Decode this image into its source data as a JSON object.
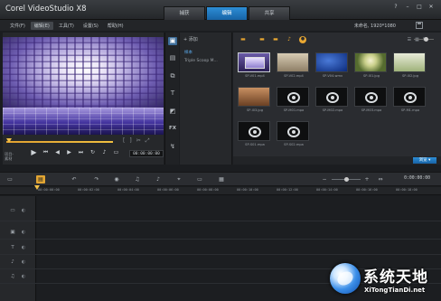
{
  "app": {
    "title": "Corel VideoStudio X8"
  },
  "steps": [
    {
      "label": "捕获",
      "active": false
    },
    {
      "label": "编辑",
      "active": true
    },
    {
      "label": "共享",
      "active": false
    }
  ],
  "window_controls": {
    "help": "?",
    "minimize": "–",
    "maximize": "□",
    "close": "✕"
  },
  "menu": [
    {
      "label": "文件(F)",
      "active": false
    },
    {
      "label": "编辑(E)",
      "active": true
    },
    {
      "label": "工具(T)",
      "active": false
    },
    {
      "label": "设置(S)",
      "active": false
    },
    {
      "label": "帮助(H)",
      "active": false
    }
  ],
  "user_status": "未命名, 1920*1080",
  "player": {
    "project_label": "项目-\n素材",
    "timecode": "00:00:00:00",
    "transport_icons": [
      "play-icon",
      "go-to-start-icon",
      "previous-frame-icon",
      "next-frame-icon",
      "go-to-end-icon",
      "repeat-icon",
      "volume-icon",
      "hd-icon"
    ],
    "trim_icons": [
      "mark-in-icon",
      "mark-out-icon",
      "split-clip-icon",
      "enlarge-icon"
    ]
  },
  "library_sidebar": [
    {
      "name": "media-icon",
      "glyph": "▣",
      "active": true
    },
    {
      "name": "instant-project-icon",
      "glyph": "▤",
      "active": false
    },
    {
      "name": "transition-icon",
      "glyph": "⧉",
      "active": false
    },
    {
      "name": "title-icon",
      "glyph": "T",
      "active": false
    },
    {
      "name": "graphic-icon",
      "glyph": "◩",
      "active": false
    },
    {
      "name": "filter-icon",
      "glyph": "FX",
      "active": false
    },
    {
      "name": "path-icon",
      "glyph": "↯",
      "active": false
    }
  ],
  "folder_panel": {
    "add_label": "+ 添加",
    "folders": [
      "样本",
      "Triple Scoop M..."
    ]
  },
  "media_panel": {
    "thumbnails": [
      {
        "label": "SP-V01.mp4",
        "kind": "video-purple",
        "selected": true
      },
      {
        "label": "SP-V02.mp4",
        "kind": "video-beige",
        "selected": false
      },
      {
        "label": "SP-V04.wmv",
        "kind": "video-blue",
        "selected": false
      },
      {
        "label": "SP-I01.jpg",
        "kind": "photo-dandelion",
        "selected": false
      },
      {
        "label": "SP-I02.jpg",
        "kind": "photo-grass",
        "selected": false
      },
      {
        "label": "SP-I03.jpg",
        "kind": "photo-room",
        "selected": false
      },
      {
        "label": "SP-M01.mpa",
        "kind": "audio",
        "selected": false
      },
      {
        "label": "SP-M02.mpa",
        "kind": "audio",
        "selected": false
      },
      {
        "label": "SP-M03.mpa",
        "kind": "audio",
        "selected": false
      },
      {
        "label": "SP-M1.mpa",
        "kind": "audio",
        "selected": false
      },
      {
        "label": "SP-S01.mpa",
        "kind": "audio",
        "selected": false
      },
      {
        "label": "SP-S02.mpa",
        "kind": "audio",
        "selected": false
      }
    ],
    "browse_label": "浏览 ▾"
  },
  "timeline": {
    "timecode": "0:00:00:00",
    "ruler_ticks": [
      "00:00:00:00",
      "00:00:02:00",
      "00:00:04:00",
      "00:00:06:00",
      "00:00:08:00",
      "00:00:10:00",
      "00:00:12:00",
      "00:00:14:00",
      "00:00:16:00",
      "00:00:18:00",
      "00:00:20:00"
    ],
    "toolbar_icons": [
      "storyboard-view-icon",
      "timeline-view-icon",
      "undo-icon",
      "redo-icon",
      "record-capture-icon",
      "sound-mixer-icon",
      "auto-music-icon",
      "motion-tracking-icon",
      "subtitle-icon",
      "multi-camera-icon",
      "zoom-out-icon",
      "zoom-in-icon",
      "fit-project-icon"
    ]
  },
  "watermark": {
    "cn": "系统天地",
    "en": "XiTongTianDi.net"
  }
}
